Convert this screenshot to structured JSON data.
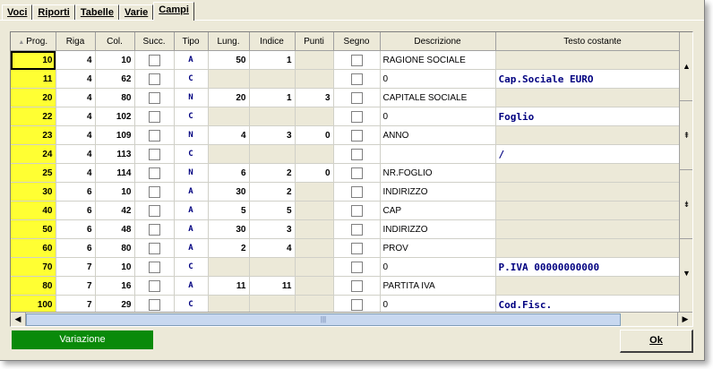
{
  "tabs": [
    {
      "label": "Voci",
      "active": false
    },
    {
      "label": "Riporti",
      "active": false
    },
    {
      "label": "Tabelle",
      "active": false
    },
    {
      "label": "Varie",
      "active": false
    },
    {
      "label": "Campi",
      "active": true
    }
  ],
  "columns": [
    "Prog.",
    "Riga",
    "Col.",
    "Succ.",
    "Tipo",
    "Lung.",
    "Indice",
    "Punti",
    "Segno",
    "Descrizione",
    "Testo costante"
  ],
  "rows": [
    {
      "prog": "10",
      "riga": "4",
      "col": "10",
      "tipo": "A",
      "lung": "50",
      "indice": "1",
      "punti": "",
      "descrizione": "RAGIONE SOCIALE",
      "testo": ""
    },
    {
      "prog": "11",
      "riga": "4",
      "col": "62",
      "tipo": "C",
      "lung": "",
      "indice": "",
      "punti": "",
      "descrizione": "0",
      "testo": "Cap.Sociale EURO"
    },
    {
      "prog": "20",
      "riga": "4",
      "col": "80",
      "tipo": "N",
      "lung": "20",
      "indice": "1",
      "punti": "3",
      "descrizione": "CAPITALE SOCIALE",
      "testo": ""
    },
    {
      "prog": "22",
      "riga": "4",
      "col": "102",
      "tipo": "C",
      "lung": "",
      "indice": "",
      "punti": "",
      "descrizione": "0",
      "testo": "Foglio"
    },
    {
      "prog": "23",
      "riga": "4",
      "col": "109",
      "tipo": "N",
      "lung": "4",
      "indice": "3",
      "punti": "0",
      "descrizione": "ANNO",
      "testo": ""
    },
    {
      "prog": "24",
      "riga": "4",
      "col": "113",
      "tipo": "C",
      "lung": "",
      "indice": "",
      "punti": "",
      "descrizione": "",
      "testo": "/"
    },
    {
      "prog": "25",
      "riga": "4",
      "col": "114",
      "tipo": "N",
      "lung": "6",
      "indice": "2",
      "punti": "0",
      "descrizione": "NR.FOGLIO",
      "testo": ""
    },
    {
      "prog": "30",
      "riga": "6",
      "col": "10",
      "tipo": "A",
      "lung": "30",
      "indice": "2",
      "punti": "",
      "descrizione": "INDIRIZZO",
      "testo": ""
    },
    {
      "prog": "40",
      "riga": "6",
      "col": "42",
      "tipo": "A",
      "lung": "5",
      "indice": "5",
      "punti": "",
      "descrizione": "CAP",
      "testo": ""
    },
    {
      "prog": "50",
      "riga": "6",
      "col": "48",
      "tipo": "A",
      "lung": "30",
      "indice": "3",
      "punti": "",
      "descrizione": "INDIRIZZO",
      "testo": ""
    },
    {
      "prog": "60",
      "riga": "6",
      "col": "80",
      "tipo": "A",
      "lung": "2",
      "indice": "4",
      "punti": "",
      "descrizione": "PROV",
      "testo": ""
    },
    {
      "prog": "70",
      "riga": "7",
      "col": "10",
      "tipo": "C",
      "lung": "",
      "indice": "",
      "punti": "",
      "descrizione": "0",
      "testo": "P.IVA 00000000000"
    },
    {
      "prog": "80",
      "riga": "7",
      "col": "16",
      "tipo": "A",
      "lung": "11",
      "indice": "11",
      "punti": "",
      "descrizione": "PARTITA IVA",
      "testo": ""
    },
    {
      "prog": "100",
      "riga": "7",
      "col": "29",
      "tipo": "C",
      "lung": "",
      "indice": "",
      "punti": "",
      "descrizione": "0",
      "testo": "Cod.Fisc."
    }
  ],
  "status_label": "Variazione",
  "ok_label": "Ok",
  "colors": {
    "prog_highlight": "#ffff33",
    "status_bg": "#0a8a0a",
    "constant_text": "#000080"
  }
}
